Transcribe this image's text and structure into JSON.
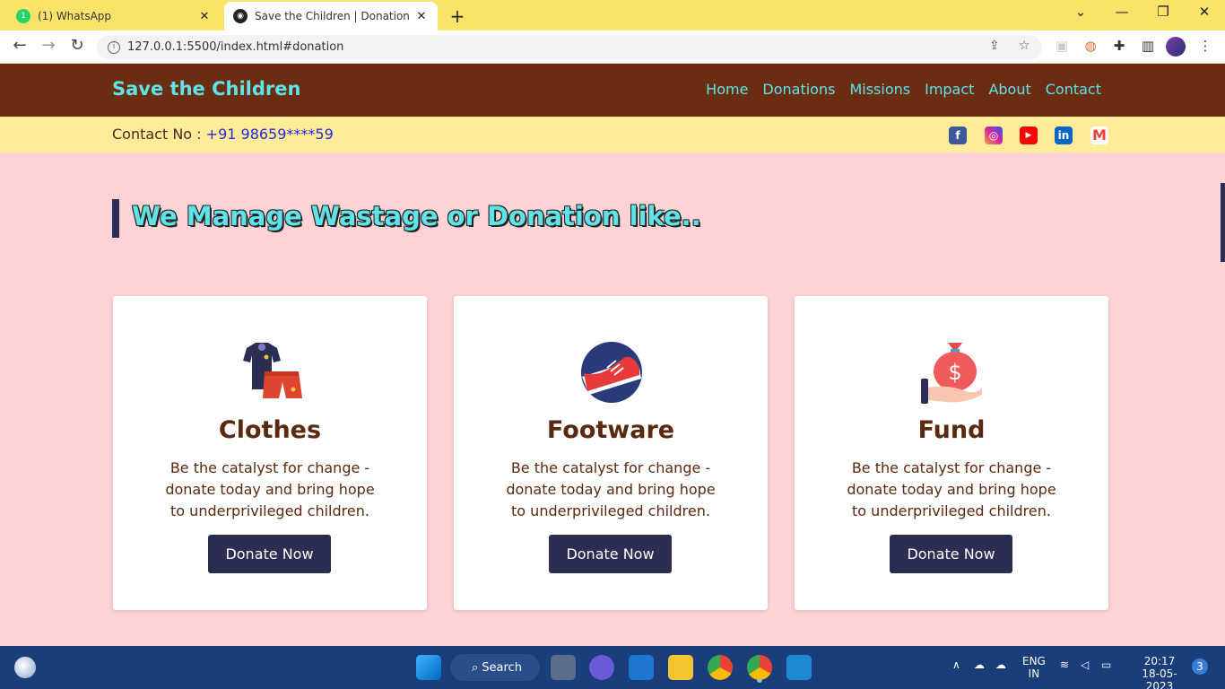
{
  "browser": {
    "tabs": [
      {
        "title": "(1) WhatsApp",
        "badge": "1"
      },
      {
        "title": "Save the Children | Donation"
      }
    ],
    "url": "127.0.0.1:5500/index.html#donation"
  },
  "site": {
    "brand": "Save the Children",
    "nav": [
      "Home",
      "Donations",
      "Missions",
      "Impact",
      "About",
      "Contact"
    ],
    "contact_label": "Contact No : ",
    "contact_number": "+91 98659****59",
    "social_icons": [
      "facebook-icon",
      "instagram-icon",
      "youtube-icon",
      "linkedin-icon",
      "gmail-icon"
    ]
  },
  "main": {
    "heading": "We Manage Wastage or Donation like..",
    "cards": [
      {
        "title": "Clothes",
        "text": "Be the catalyst for change - donate today and bring hope to underprivileged children.",
        "button": "Donate Now",
        "icon": "clothes-icon"
      },
      {
        "title": "Footware",
        "text": "Be the catalyst for change - donate today and bring hope to underprivileged children.",
        "button": "Donate Now",
        "icon": "shoe-icon"
      },
      {
        "title": "Fund",
        "text": "Be the catalyst for change - donate today and bring hope to underprivileged children.",
        "button": "Donate Now",
        "icon": "money-bag-icon"
      }
    ]
  },
  "taskbar": {
    "search_label": "Search",
    "lang_top": "ENG",
    "lang_bottom": "IN",
    "time": "20:17",
    "date": "18-05-2023",
    "notification_count": "3"
  },
  "colors": {
    "header_bg": "#6a2d12",
    "accent": "#5fe3e8",
    "contact_bar": "#ffec99",
    "page_bg": "#ffd2d6",
    "button": "#2b2d52"
  }
}
